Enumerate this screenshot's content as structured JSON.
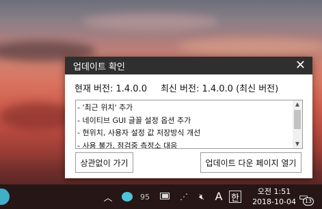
{
  "dialog": {
    "title": "업데이트 확인",
    "current_version": "현재 버전: 1.4.0.0",
    "latest_version": "최신 버전: 1.4.0.0 (최신 버전)",
    "changelog": [
      "- '최근 위치' 추가",
      "- 네이티브 GUI 글꼴 설정 옵션 추가",
      "- 현위치, 사용자 설정 값 저장방식 개선",
      "- 사용 불가, 점검중 측정소 대응"
    ],
    "ignore_button": "상관없이 가기",
    "open_button": "업데이트 다운 페이지 열기"
  },
  "taskbar": {
    "tray_number": "95",
    "ime_letter": "A",
    "ime_hangul": "한",
    "time": "오전 1:51",
    "date": "2018-10-04",
    "notification_count": "13"
  }
}
